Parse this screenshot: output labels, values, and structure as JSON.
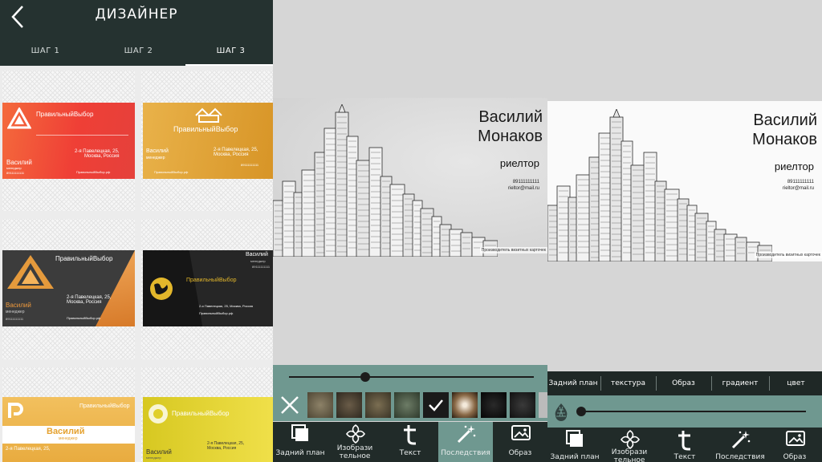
{
  "header": {
    "title": "ДИЗАЙНЕР"
  },
  "steps": [
    {
      "label": "ШАГ 1"
    },
    {
      "label": "ШАГ 2"
    },
    {
      "label": "ШАГ 3"
    }
  ],
  "cards": {
    "c1": {
      "brand": "ПравильныйВыбор",
      "name": "Василий",
      "role": "менеджер",
      "address": "2-я Павелецкая, 25,\nМосква, Россия",
      "phone": "89111111111",
      "site": "ПравильныйВыбор.рф"
    },
    "c2": {
      "brand": "ПравильныйВыбор",
      "name": "Василий",
      "role": "менеджер",
      "address": "2-я Павелецкая, 25,\nМосква, Россия",
      "phone": "89111111111",
      "site": "ПравильныйВыбор.рф"
    },
    "c3": {
      "brand": "ПравильныйВыбор",
      "name": "Василий",
      "role": "менеджер",
      "phone": "89111111111",
      "address": "2-я Павелецкая, 25,\nМосква, Россия",
      "site": "ПравильныйВыбор.рф"
    },
    "c4": {
      "brand": "ПравильныйВыбор",
      "name": "Василий",
      "role": "менеджер",
      "phone": "89111111111",
      "address": "2-я Павелецкая, 25, Москва, Россия",
      "site": "ПравильныйВыбор.рф"
    },
    "c5": {
      "brand": "ПравильныйВыбор",
      "name": "Василий",
      "role": "менеджер",
      "address": "2-я Павелецкая, 25,"
    },
    "c6": {
      "brand": "ПравильныйВыбор",
      "name": "Василий",
      "role": "менеджер",
      "address": "2-я Павелецкая, 25,\nМосква, Россия"
    }
  },
  "business_card": {
    "name": "Василий\nМонаков",
    "role": "риелтор",
    "phone": "89111111111",
    "email": "rieltor@mail.ru",
    "credit": "Производитель визитных карточек"
  },
  "background_tabs": [
    "Задний план",
    "текстура",
    "Образ",
    "градиент",
    "цвет"
  ],
  "bottom_nav": [
    {
      "label": "Задний план",
      "icon": "layers-icon"
    },
    {
      "label": "Изобрази\nтельное",
      "icon": "shapes-icon"
    },
    {
      "label": "Текст",
      "icon": "text-icon"
    },
    {
      "label": "Последствия",
      "icon": "magic-wand-icon"
    },
    {
      "label": "Образ",
      "icon": "image-icon"
    }
  ],
  "sliders": {
    "effect_slider_level": 0.31,
    "color_slider_level": 0.0
  },
  "colors": {
    "header_bg": "#253230",
    "accent_teal": "#6f9890",
    "nav_bg": "#212b29"
  }
}
